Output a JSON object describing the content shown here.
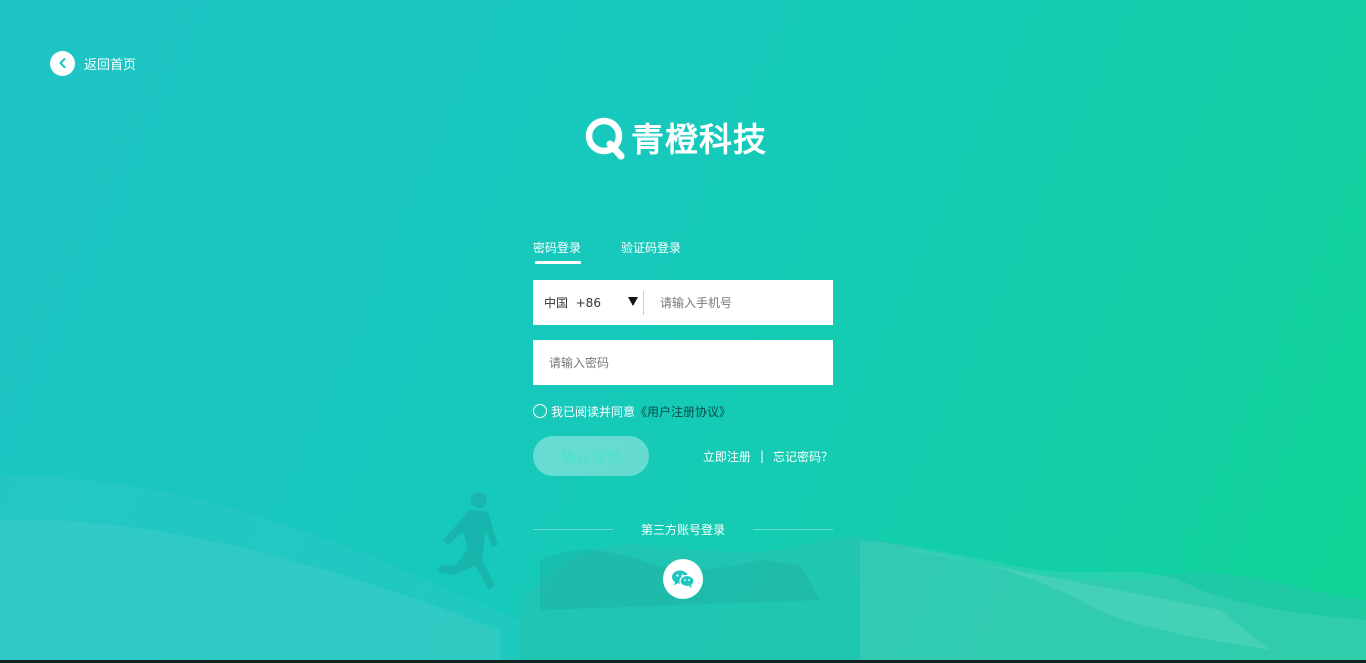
{
  "nav": {
    "back_label": "返回首页"
  },
  "brand": {
    "name": "青橙科技"
  },
  "tabs": [
    {
      "label": "密码登录",
      "active": true
    },
    {
      "label": "验证码登录",
      "active": false
    }
  ],
  "form": {
    "country_code": "中国  +86",
    "phone_placeholder": "请输入手机号",
    "password_placeholder": "请输入密码",
    "agree_text": "我已阅读并同意",
    "protocol_link": "《用户注册协议》",
    "submit_label": "确认登录",
    "register_link": "立即注册",
    "separator": "|",
    "forgot_link": "忘记密码？"
  },
  "third_party": {
    "label": "第三方账号登录",
    "providers": [
      {
        "icon": "wechat-icon"
      }
    ]
  },
  "colors": {
    "bg_start": "#1fc4c6",
    "bg_end": "#11d493",
    "primary": "#16c9bb"
  }
}
